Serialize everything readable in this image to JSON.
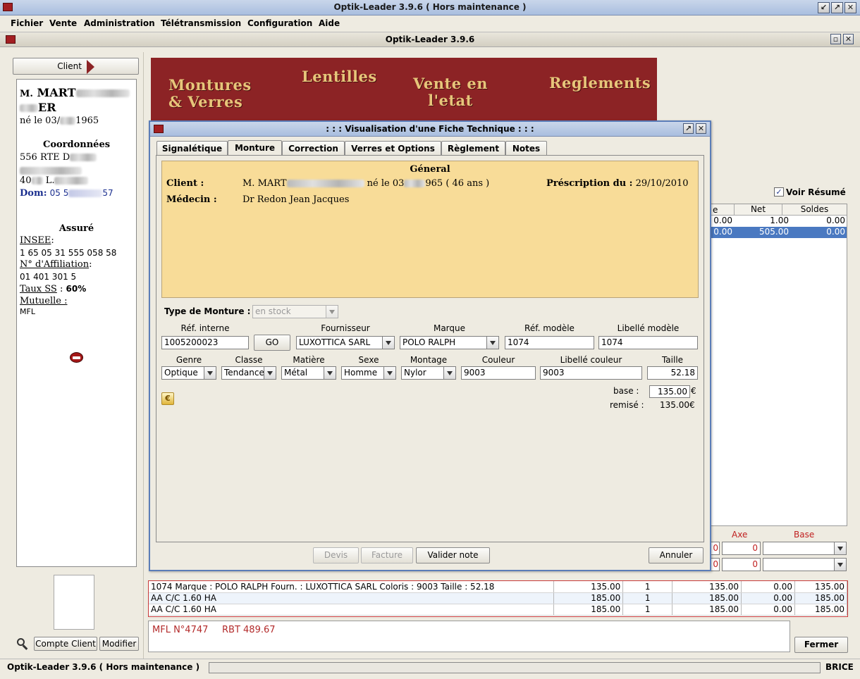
{
  "window": {
    "title": "Optik-Leader 3.9.6 ( Hors maintenance )",
    "inner_title": "Optik-Leader 3.9.6"
  },
  "menu": [
    "Fichier",
    "Vente",
    "Administration",
    "Télétransmission",
    "Configuration",
    "Aide"
  ],
  "left_panel": {
    "client_button": "Client",
    "name_prefix": "M.",
    "name_line1": "MART",
    "name_line2": "ER",
    "born": "né le 03/",
    "born_year": "1965",
    "coord_title": "Coordonnées",
    "address1": "556 RTE D",
    "address3_prefix": "40",
    "address3_mid": "L.",
    "dom_label": "Dom:",
    "dom_prefix": "05 5",
    "dom_suffix": "57",
    "assure_title": "Assuré",
    "insee_label": "INSEE",
    "insee_value": "1 65 05 31 555 058 58",
    "affiliation_label": "N° d'Affiliation",
    "affiliation_value": "01 401 301 5",
    "taux_label": "Taux SS",
    "taux_value": "60%",
    "mutuelle_label": "Mutuelle :",
    "mutuelle_value": "MFL",
    "compte_button": "Compte Client",
    "modifier_button": "Modifier"
  },
  "banner": {
    "montures": "Montures\n& Verres",
    "lentilles": "Lentilles",
    "vente": "Vente en\nl'etat",
    "reglements": "Reglements"
  },
  "right_panel": {
    "voir_resume": "Voir Résumé",
    "headers": [
      "e",
      "Net",
      "Soldes"
    ],
    "rows": [
      [
        "0.00",
        "1.00",
        "0.00"
      ],
      [
        "0.00",
        "505.00",
        "0.00"
      ]
    ],
    "axe_label": "Axe",
    "base_label": "Base",
    "axe_values": [
      "0",
      "0"
    ],
    "row_prefix": [
      "0",
      "0"
    ]
  },
  "dialog": {
    "title": ": : : Visualisation d'une Fiche Technique : : :",
    "tabs": [
      "Signalétique",
      "Monture",
      "Correction",
      "Verres et Options",
      "Règlement",
      "Notes"
    ],
    "general_title": "Géneral",
    "client_label": "Client :",
    "client_prefix": "M. MART",
    "client_born": "né le 03",
    "client_born_suffix": "965 ( 46 ans )",
    "prescription_label": "Préscription du :",
    "prescription_date": "29/10/2010",
    "medecin_label": "Médecin :",
    "medecin_value": "Dr Redon Jean Jacques",
    "type_monture_label": "Type de Monture :",
    "type_monture_value": "en stock",
    "labels1": [
      "Réf. interne",
      "Fournisseur",
      "Marque",
      "Réf. modèle",
      "Libellé modèle"
    ],
    "ref_interne": "1005200023",
    "go_button": "GO",
    "fournisseur": "LUXOTTICA SARL",
    "marque": "POLO RALPH",
    "ref_modele": "1074",
    "libelle_modele": "1074",
    "labels2": [
      "Genre",
      "Classe",
      "Matière",
      "Sexe",
      "Montage",
      "Couleur",
      "Libellé couleur",
      "Taille"
    ],
    "genre": "Optique",
    "classe": "Tendance",
    "matiere": "Métal",
    "sexe": "Homme",
    "montage": "Nylor",
    "couleur": "9003",
    "libelle_couleur": "9003",
    "taille": "52.18",
    "base_label": "base :",
    "base_value": "135.00",
    "euro": "€",
    "remise_label": "remisé :",
    "remise_value": "135.00€",
    "devis_button": "Devis",
    "facture_button": "Facture",
    "valider_button": "Valider note",
    "annuler_button": "Annuler"
  },
  "lines": [
    {
      "desc": "1074   Marque : POLO RALPH   Fourn. : LUXOTTICA SARL   Coloris : 9003   Taille : 52.18",
      "pu": "135.00",
      "qte": "1",
      "total": "135.00",
      "remise": "0.00",
      "net": "135.00"
    },
    {
      "desc": "AA C/C 1.60 HA",
      "pu": "185.00",
      "qte": "1",
      "total": "185.00",
      "remise": "0.00",
      "net": "185.00"
    },
    {
      "desc": "AA C/C 1.60 HA",
      "pu": "185.00",
      "qte": "1",
      "total": "185.00",
      "remise": "0.00",
      "net": "185.00"
    }
  ],
  "note": {
    "mfl": "MFL N°4747",
    "rbt": "RBT 489.67"
  },
  "fermer_button": "Fermer",
  "status": {
    "left": "Optik-Leader 3.9.6 ( Hors maintenance )",
    "user": "BRICE"
  },
  "colors": {
    "accent_red": "#8c2325",
    "selection_blue": "#4a79c1",
    "panel_bg": "#f8dc98",
    "note_red": "#b32b2b"
  }
}
